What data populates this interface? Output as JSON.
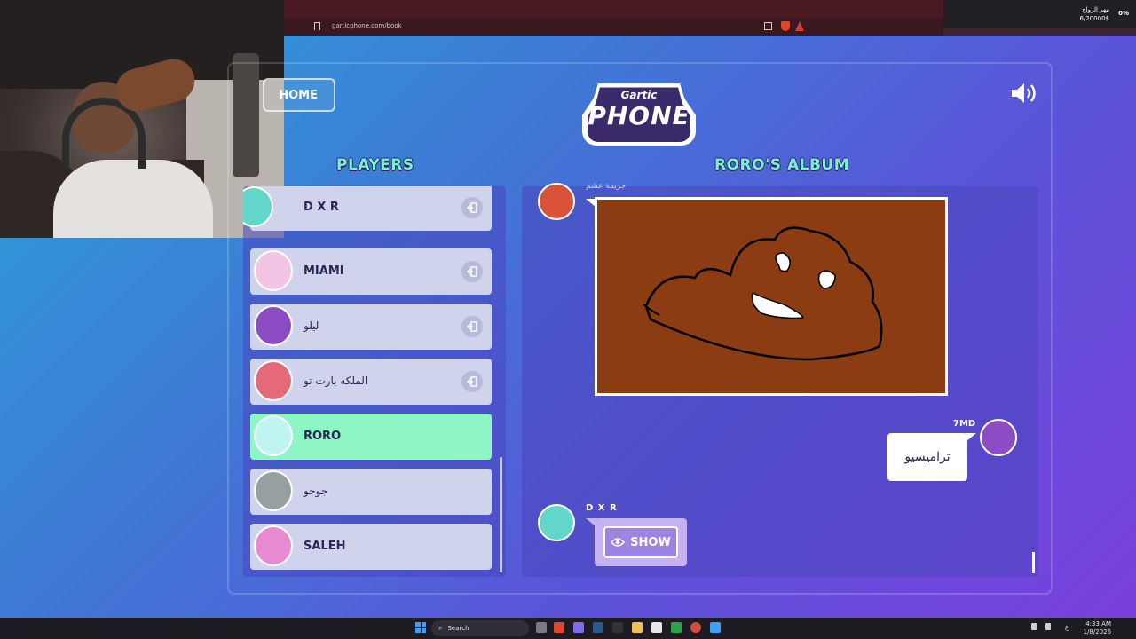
{
  "browser": {
    "url": "garticphone.com/book"
  },
  "wallet": {
    "label": "مهر الزواج",
    "amount": "6/20000$",
    "percent": "0%"
  },
  "header": {
    "home_label": "HOME",
    "logo_top": "Gartic",
    "logo_main": "PHONE"
  },
  "players_panel": {
    "title": "PLAYERS",
    "players": [
      {
        "name": "D X R",
        "kick": true,
        "active": false,
        "avatar_color": "#62d6c8"
      },
      {
        "name": "MIAMI",
        "kick": true,
        "active": false,
        "avatar_color": "#f3c4e4"
      },
      {
        "name": "ليلو",
        "kick": true,
        "active": false,
        "avatar_color": "#8b4cc4"
      },
      {
        "name": "الملكه بارت تو",
        "kick": true,
        "active": false,
        "avatar_color": "#e46a7a"
      },
      {
        "name": "RORO",
        "kick": false,
        "active": true,
        "avatar_color": "#bff4f0"
      },
      {
        "name": "جوجو",
        "kick": false,
        "active": false,
        "avatar_color": "#97a0a0"
      },
      {
        "name": "SALEH",
        "kick": false,
        "active": false,
        "avatar_color": "#e78ad1"
      }
    ]
  },
  "album": {
    "title": "RORO'S ALBUM",
    "top_label": "جريمة عشم",
    "guess_player": "7MD",
    "guess_text": "تراميسيو",
    "next_player": "D X R",
    "show_label": "SHOW"
  },
  "taskbar": {
    "search_placeholder": "Search",
    "time": "4:33 AM",
    "date": "1/8/2026",
    "lang": "ع"
  }
}
